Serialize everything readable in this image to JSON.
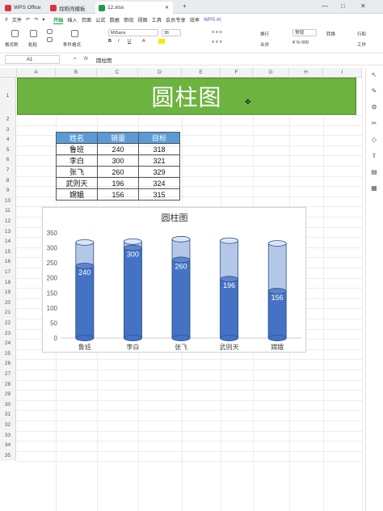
{
  "window": {
    "tabs": [
      {
        "label": "WPS Office",
        "color": "#d9333f"
      },
      {
        "label": "找稻壳模板",
        "color": "#d9333f"
      },
      {
        "label": "12.xlsx",
        "color": "#1a9e45"
      }
    ],
    "new_tab": "+",
    "win_controls": [
      "—",
      "□",
      "✕"
    ]
  },
  "menu": {
    "file": "文件",
    "items": [
      "开始",
      "插入",
      "页面",
      "公式",
      "数据",
      "审阅",
      "视图",
      "工具",
      "会员专享",
      "效率"
    ],
    "active": "开始",
    "wps_ai": "WPS AI"
  },
  "toolbar": {
    "format_painter": "格式刷",
    "paste": "粘贴",
    "conditional_format": "条件格式",
    "font_name": "MiSans",
    "font_size": "36",
    "wrap": "换行",
    "merge": "合并",
    "number_format": "常规",
    "convert": "转换",
    "row_col": "行和",
    "worksheet": "工作"
  },
  "formula_bar": {
    "cell_ref": "A1",
    "fx": "fx",
    "content": "圆柱图"
  },
  "columns": [
    "A",
    "B",
    "C",
    "D",
    "E",
    "F",
    "G",
    "H",
    "I"
  ],
  "rows": [
    "1",
    "2",
    "3",
    "4",
    "5",
    "6",
    "7",
    "8",
    "9",
    "10",
    "11",
    "12",
    "13",
    "14",
    "15",
    "16",
    "17",
    "18",
    "19",
    "20",
    "21",
    "22",
    "23",
    "24",
    "25",
    "26",
    "27",
    "28",
    "29",
    "30",
    "31",
    "32",
    "33",
    "34",
    "35"
  ],
  "banner": {
    "title": "圆柱图",
    "color": "#6db33f"
  },
  "table": {
    "headers": [
      "姓名",
      "销量",
      "目标"
    ],
    "rows": [
      [
        "鲁班",
        "240",
        "318"
      ],
      [
        "李白",
        "300",
        "321"
      ],
      [
        "张飞",
        "260",
        "329"
      ],
      [
        "武则天",
        "196",
        "324"
      ],
      [
        "嫦娥",
        "156",
        "315"
      ]
    ],
    "header_color": "#5b9bd5"
  },
  "chart_data": {
    "type": "bar",
    "title": "圆柱图",
    "categories": [
      "鲁班",
      "李白",
      "张飞",
      "武则天",
      "嫦娥"
    ],
    "series": [
      {
        "values": [
          240,
          300,
          260,
          196,
          156
        ]
      },
      {
        "values": [
          318,
          321,
          329,
          324,
          315
        ]
      }
    ],
    "ylim": [
      0,
      350
    ],
    "yticks": [
      0,
      50,
      100,
      150,
      200,
      250,
      300,
      350
    ],
    "data_labels": true,
    "colors": {
      "sales": "#4472c4",
      "target": "#b4c7e7"
    }
  }
}
